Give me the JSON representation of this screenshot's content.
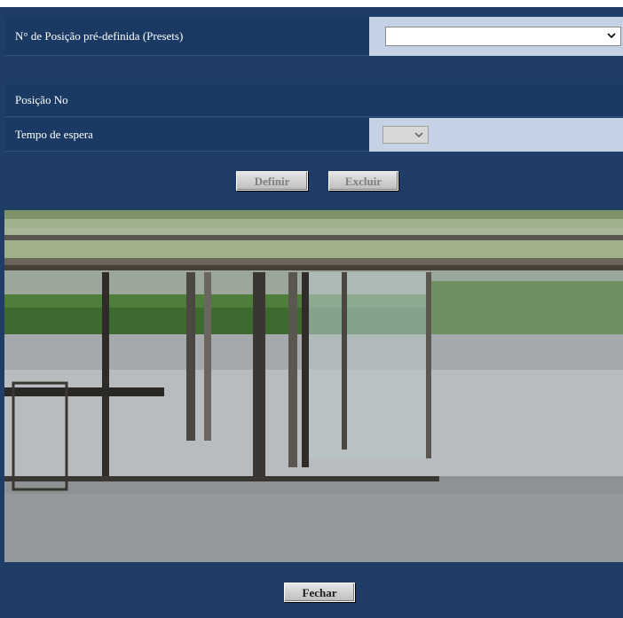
{
  "preset": {
    "label": "N° de Posição pré-definida (Presets)",
    "value": ""
  },
  "position": {
    "label": "Posição No"
  },
  "wait": {
    "label": "Tempo de espera",
    "value": ""
  },
  "buttons": {
    "set": "Definir",
    "delete": "Excluir",
    "close": "Fechar"
  },
  "icons": {
    "dropdown": "chevron-down-icon"
  },
  "colors": {
    "panel": "#1f3d66",
    "value_cell": "#c5d2e6"
  }
}
